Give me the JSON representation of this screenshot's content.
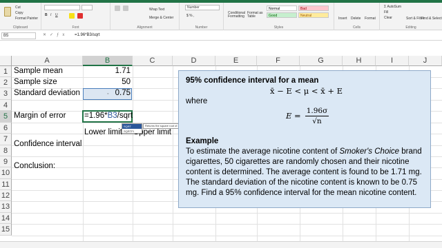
{
  "ribbon": {
    "clipboard": {
      "cut": "Cut",
      "copy": "Copy",
      "format_painter": "Format Painter",
      "label": "Clipboard"
    },
    "font": {
      "label": "Font"
    },
    "alignment": {
      "wrap_text": "Wrap Text",
      "merge_center": "Merge & Center",
      "label": "Alignment"
    },
    "number": {
      "format": "Number",
      "label": "Number"
    },
    "styles": {
      "conditional": "Conditional Formatting",
      "format_as_table": "Format as Table",
      "normal": "Normal",
      "bad": "Bad",
      "good": "Good",
      "neutral": "Neutral",
      "label": "Styles"
    },
    "cells": {
      "insert": "Insert",
      "delete": "Delete",
      "format": "Format",
      "label": "Cells"
    },
    "editing": {
      "autosum": "AutoSum",
      "fill": "Fill",
      "clear": "Clear",
      "sort_filter": "Sort & Filter",
      "find_select": "Find & Select",
      "label": "Editing"
    }
  },
  "formula_bar": {
    "name_box": "B5",
    "formula": "=1.96*B3/sqrt"
  },
  "grid": {
    "columns": [
      "A",
      "B",
      "C",
      "D",
      "E",
      "F",
      "G",
      "H",
      "I",
      "J"
    ],
    "rows": [
      "1",
      "2",
      "3",
      "4",
      "5",
      "6",
      "7",
      "8",
      "9",
      "10",
      "11",
      "12",
      "13",
      "14",
      "15"
    ],
    "cells": {
      "a1": "Sample mean",
      "b1": "1.71",
      "a2": "Sample size",
      "b2": "50",
      "a3": "Standard deviation",
      "b3": "0.75",
      "a5": "Margin of error",
      "b5_prefix": "=1.96*",
      "b5_ref": "B3",
      "b5_suffix": "/sqrt",
      "b6": "Lower limit",
      "c6": "Upper limit",
      "a7": "Confidence interval",
      "a9": "Conclusion:"
    }
  },
  "autocomplete": {
    "items": [
      "SQRT",
      "SQRTPI"
    ],
    "tooltip": "Returns the square root of a number"
  },
  "infobox": {
    "title": "95% confidence interval for a mean",
    "formula": "x̄ − E < μ < x̄ + E",
    "where": "where",
    "e_lhs": "E =",
    "e_num": "1.96σ",
    "e_den": "√n",
    "example_heading": "Example",
    "example_pre": "To estimate the average nicotine content of ",
    "example_brand": "Smoker's Choice",
    "example_post": " brand cigarettes, 50 cigarettes are randomly chosen and their nicotine content is determined. The average content is found to be 1.71 mg. The standard deviation of the nicotine content is known to be 0.75 mg. Find a 95% confidence interval for the mean nicotine content."
  },
  "colors": {
    "excel_green": "#217346",
    "box_fill": "#dbe8f5",
    "ref_blue": "#2b579a"
  }
}
